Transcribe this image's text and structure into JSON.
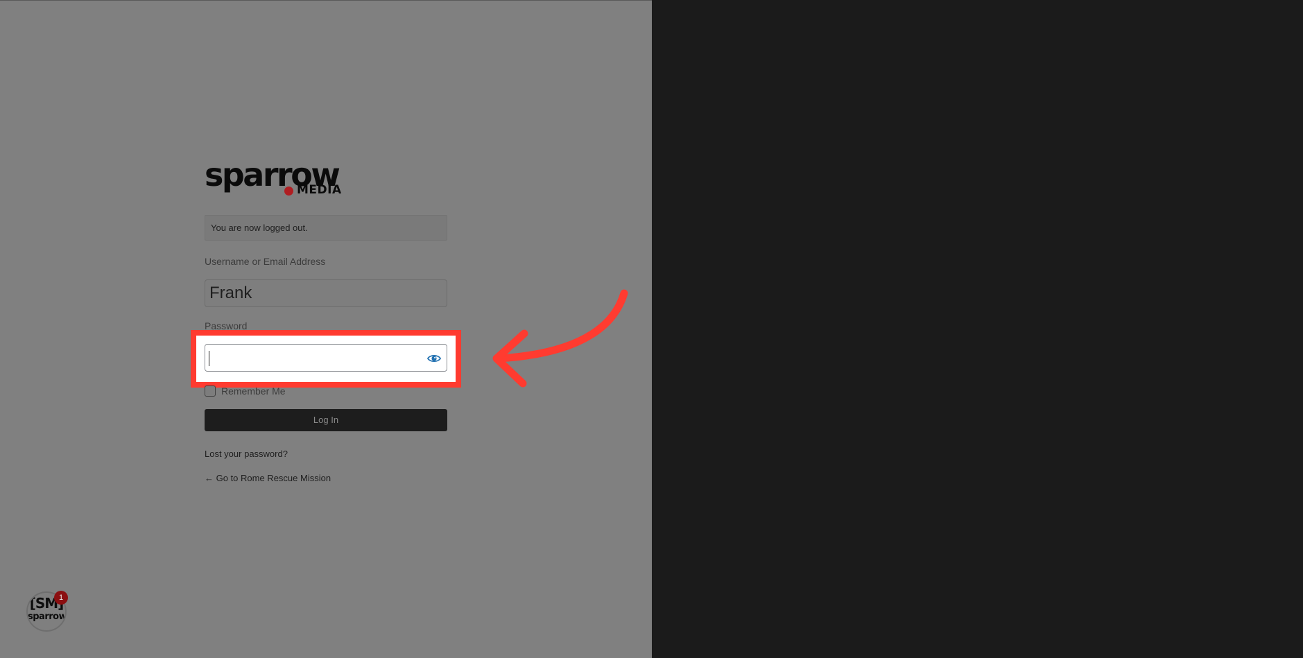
{
  "logo": {
    "main": "sparrow",
    "sub": "MEDIA"
  },
  "message": "You are now logged out.",
  "form": {
    "username_label": "Username or Email Address",
    "username_value": "Frank",
    "password_label": "Password",
    "password_value": "",
    "remember_label": "Remember Me",
    "login_label": "Log In"
  },
  "links": {
    "lost_password": "Lost your password?",
    "back_to_site": "← Go to Rome Rescue Mission"
  },
  "avatar": {
    "initials": "[SM]",
    "word": "sparrow"
  },
  "notification_count": "1",
  "icons": {
    "show_password": "eye-icon",
    "annotation": "curved-arrow-icon"
  },
  "colors": {
    "highlight": "#ff3b30",
    "eye_icon": "#2271b1",
    "button": "#1d1d1d"
  }
}
